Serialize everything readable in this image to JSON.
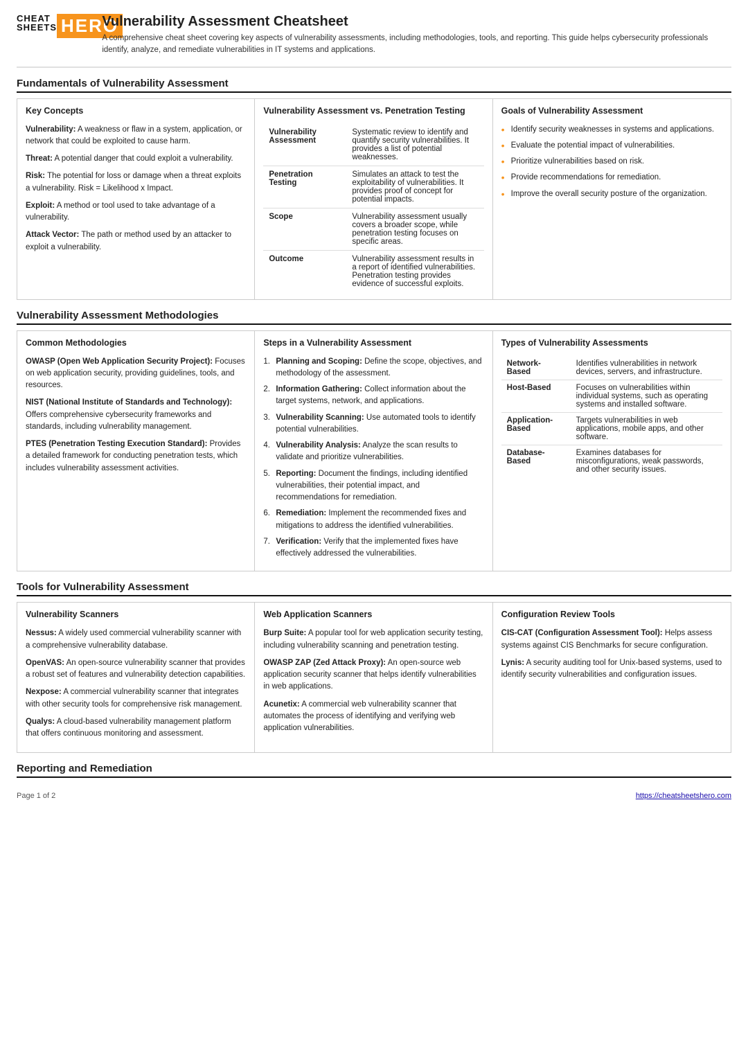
{
  "header": {
    "logo_cheat": "CHEAT",
    "logo_sheets": "SHEETS",
    "logo_hero": "HERO",
    "title": "Vulnerability Assessment Cheatsheet",
    "description": "A comprehensive cheat sheet covering key aspects of vulnerability assessments, including methodologies, tools, and reporting. This guide helps cybersecurity professionals identify, analyze, and remediate vulnerabilities in IT systems and applications."
  },
  "section1": {
    "heading": "Fundamentals of Vulnerability Assessment",
    "col1_header": "Key Concepts",
    "col2_header": "Vulnerability Assessment vs. Penetration Testing",
    "col3_header": "Goals of Vulnerability Assessment",
    "concepts": [
      {
        "term": "Vulnerability:",
        "desc": "A weakness or flaw in a system, application, or network that could be exploited to cause harm."
      },
      {
        "term": "Threat:",
        "desc": "A potential danger that could exploit a vulnerability."
      },
      {
        "term": "Risk:",
        "desc": "The potential for loss or damage when a threat exploits a vulnerability. Risk = Likelihood x Impact."
      },
      {
        "term": "Exploit:",
        "desc": "A method or tool used to take advantage of a vulnerability."
      },
      {
        "term": "Attack Vector:",
        "desc": "The path or method used by an attacker to exploit a vulnerability."
      }
    ],
    "vs_rows": [
      {
        "term": "Vulnerability Assessment",
        "desc": "Systematic review to identify and quantify security vulnerabilities. It provides a list of potential weaknesses."
      },
      {
        "term": "Penetration Testing",
        "desc": "Simulates an attack to test the exploitability of vulnerabilities. It provides proof of concept for potential impacts."
      },
      {
        "term": "Scope",
        "desc": "Vulnerability assessment usually covers a broader scope, while penetration testing focuses on specific areas."
      },
      {
        "term": "Outcome",
        "desc": "Vulnerability assessment results in a report of identified vulnerabilities. Penetration testing provides evidence of successful exploits."
      }
    ],
    "goals": [
      "Identify security weaknesses in systems and applications.",
      "Evaluate the potential impact of vulnerabilities.",
      "Prioritize vulnerabilities based on risk.",
      "Provide recommendations for remediation.",
      "Improve the overall security posture of the organization."
    ]
  },
  "section2": {
    "heading": "Vulnerability Assessment Methodologies",
    "col1_header": "Common Methodologies",
    "col2_header": "Steps in a Vulnerability Assessment",
    "col3_header": "Types of Vulnerability Assessments",
    "methodologies": [
      {
        "term": "OWASP (Open Web Application Security Project):",
        "desc": "Focuses on web application security, providing guidelines, tools, and resources."
      },
      {
        "term": "NIST (National Institute of Standards and Technology):",
        "desc": "Offers comprehensive cybersecurity frameworks and standards, including vulnerability management."
      },
      {
        "term": "PTES (Penetration Testing Execution Standard):",
        "desc": "Provides a detailed framework for conducting penetration tests, which includes vulnerability assessment activities."
      }
    ],
    "steps": [
      {
        "num": "1.",
        "term": "Planning and Scoping:",
        "desc": "Define the scope, objectives, and methodology of the assessment."
      },
      {
        "num": "2.",
        "term": "Information Gathering:",
        "desc": "Collect information about the target systems, network, and applications."
      },
      {
        "num": "3.",
        "term": "Vulnerability Scanning:",
        "desc": "Use automated tools to identify potential vulnerabilities."
      },
      {
        "num": "4.",
        "term": "Vulnerability Analysis:",
        "desc": "Analyze the scan results to validate and prioritize vulnerabilities."
      },
      {
        "num": "5.",
        "term": "Reporting:",
        "desc": "Document the findings, including identified vulnerabilities, their potential impact, and recommendations for remediation."
      },
      {
        "num": "6.",
        "term": "Remediation:",
        "desc": "Implement the recommended fixes and mitigations to address the identified vulnerabilities."
      },
      {
        "num": "7.",
        "term": "Verification:",
        "desc": "Verify that the implemented fixes have effectively addressed the vulnerabilities."
      }
    ],
    "types": [
      {
        "type": "Network-\nBased",
        "desc": "Identifies vulnerabilities in network devices, servers, and infrastructure."
      },
      {
        "type": "Host-Based",
        "desc": "Focuses on vulnerabilities within individual systems, such as operating systems and installed software."
      },
      {
        "type": "Application-\nBased",
        "desc": "Targets vulnerabilities in web applications, mobile apps, and other software."
      },
      {
        "type": "Database-\nBased",
        "desc": "Examines databases for misconfigurations, weak passwords, and other security issues."
      }
    ]
  },
  "section3": {
    "heading": "Tools for Vulnerability Assessment",
    "col1_header": "Vulnerability Scanners",
    "col2_header": "Web Application Scanners",
    "col3_header": "Configuration Review Tools",
    "scanners": [
      {
        "term": "Nessus:",
        "desc": "A widely used commercial vulnerability scanner with a comprehensive vulnerability database."
      },
      {
        "term": "OpenVAS:",
        "desc": "An open-source vulnerability scanner that provides a robust set of features and vulnerability detection capabilities."
      },
      {
        "term": "Nexpose:",
        "desc": "A commercial vulnerability scanner that integrates with other security tools for comprehensive risk management."
      },
      {
        "term": "Qualys:",
        "desc": "A cloud-based vulnerability management platform that offers continuous monitoring and assessment."
      }
    ],
    "web_scanners": [
      {
        "term": "Burp Suite:",
        "desc": "A popular tool for web application security testing, including vulnerability scanning and penetration testing."
      },
      {
        "term": "OWASP ZAP (Zed Attack Proxy):",
        "desc": "An open-source web application security scanner that helps identify vulnerabilities in web applications."
      },
      {
        "term": "Acunetix:",
        "desc": "A commercial web vulnerability scanner that automates the process of identifying and verifying web application vulnerabilities."
      }
    ],
    "config_tools": [
      {
        "term": "CIS-CAT (Configuration Assessment Tool):",
        "desc": "Helps assess systems against CIS Benchmarks for secure configuration."
      },
      {
        "term": "Lynis:",
        "desc": "A security auditing tool for Unix-based systems, used to identify security vulnerabilities and configuration issues."
      }
    ]
  },
  "section4": {
    "heading": "Reporting and Remediation"
  },
  "footer": {
    "page": "Page 1 of 2",
    "url": "https://cheatsheetshero.com",
    "url_text": "https://cheatsheetshero.com"
  }
}
